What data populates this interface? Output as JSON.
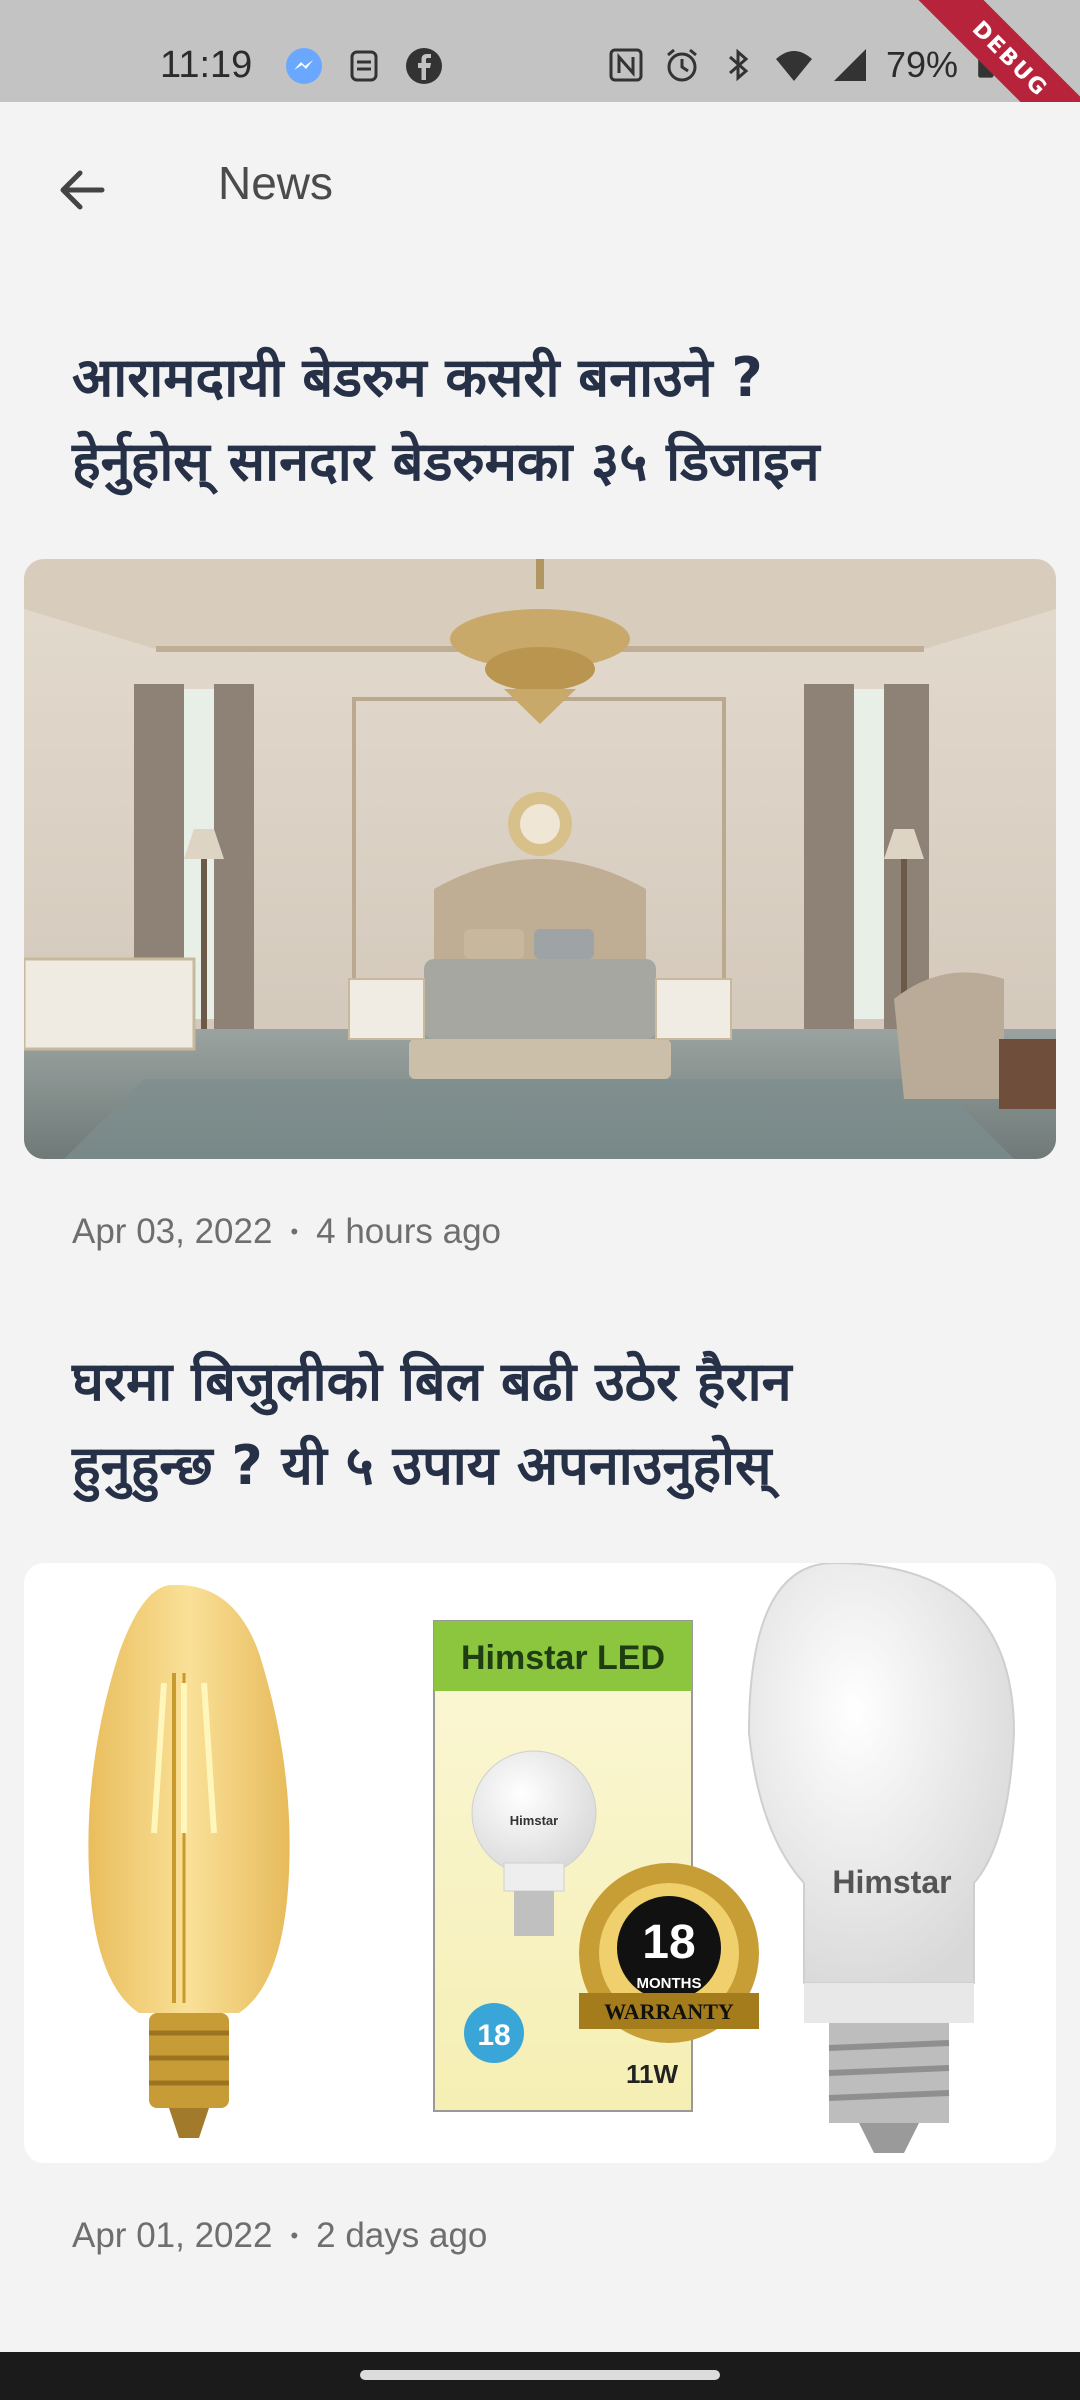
{
  "status_bar": {
    "time": "11:19",
    "battery": "79%",
    "left_icons": [
      "messenger-icon",
      "app-notification-icon",
      "facebook-icon"
    ],
    "right_icons": [
      "nfc-icon",
      "alarm-icon",
      "bluetooth-icon",
      "wifi-icon",
      "signal-icon",
      "battery-icon"
    ]
  },
  "debug_banner": "DEBUG",
  "app_bar": {
    "title": "News",
    "back_icon": "arrow-left-icon"
  },
  "articles": [
    {
      "title_line1": "आरामदायी बेडरुम कसरी बनाउने ?",
      "title_line2": "हेर्नुहोस् सानदार बेडरुमका ३५ डिजाइन",
      "date": "Apr 03, 2022",
      "separator": "•",
      "ago": "4 hours ago"
    },
    {
      "title_line1": "घरमा बिजुलीको बिल बढी उठेर हैरान",
      "title_line2": "हुनुहुन्छ ? यी ५ उपाय अपनाउनुहोस्",
      "date": "Apr 01, 2022",
      "separator": "•",
      "ago": "2 days ago",
      "image_text": {
        "box_brand": "Himstar LED",
        "box_bulb_label": "Himstar",
        "badge_number": "18",
        "badge_months": "MONTHS",
        "badge_warranty": "WARRANTY",
        "box_watts": "11W",
        "box_small_badge": "18",
        "bulb_brand": "Himstar"
      }
    }
  ],
  "colors": {
    "background": "#f3f3f3",
    "status_bar": "#c3c3c3",
    "title_text": "#263047",
    "meta_text": "#6e6e6e",
    "debug_banner": "#b7233a"
  }
}
